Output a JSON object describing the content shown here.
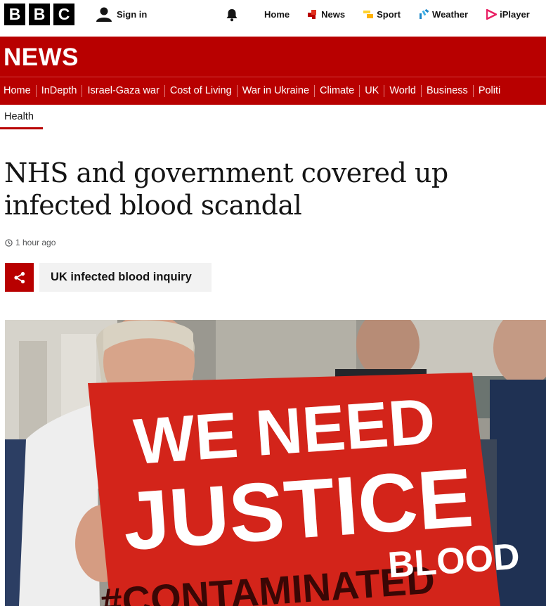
{
  "brand": {
    "letters": [
      "B",
      "B",
      "C"
    ]
  },
  "account": {
    "signin_label": "Sign in"
  },
  "topnav": [
    {
      "label": "Home",
      "icon": ""
    },
    {
      "label": "News",
      "icon": "news-icon"
    },
    {
      "label": "Sport",
      "icon": "sport-icon"
    },
    {
      "label": "Weather",
      "icon": "weather-icon"
    },
    {
      "label": "iPlayer",
      "icon": "iplayer-icon"
    }
  ],
  "news_header": {
    "title": "NEWS"
  },
  "section_nav": [
    "Home",
    "InDepth",
    "Israel-Gaza war",
    "Cost of Living",
    "War in Ukraine",
    "Climate",
    "UK",
    "World",
    "Business",
    "Politi"
  ],
  "subsection": {
    "label": "Health"
  },
  "article": {
    "headline": "NHS and government covered up infected blood scandal",
    "timestamp": "1 hour ago",
    "topic": "UK infected blood inquiry"
  },
  "hero_image": {
    "sign_lines": [
      "WE NEED",
      "JUSTICE",
      "#CONTAMINATED",
      "BLOOD"
    ]
  },
  "colors": {
    "brand_red": "#b80000",
    "topic_bg": "#f2f2f2",
    "text": "#141414"
  }
}
